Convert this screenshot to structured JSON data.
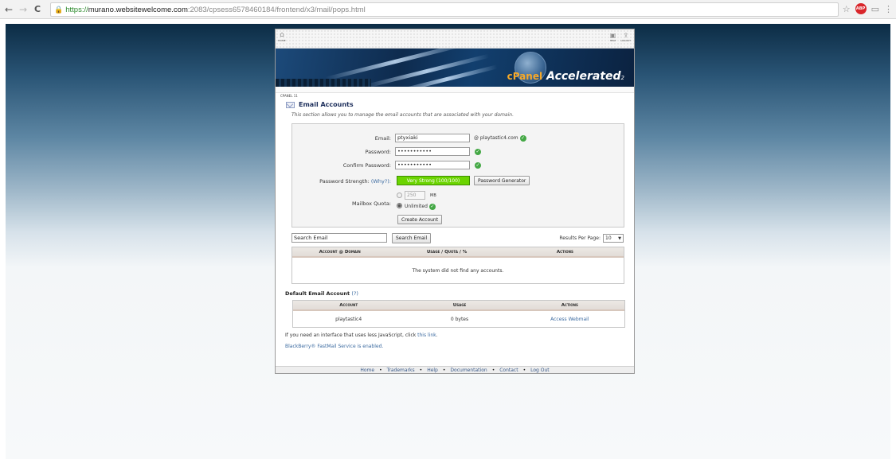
{
  "browser": {
    "url_proto": "https://",
    "url_host": "murano.websitewelcome.com",
    "url_path": ":2083/cpsess6578460184/frontend/x3/mail/pops.html",
    "adblock_label": "ABP"
  },
  "topbar": {
    "home_label": "HOME",
    "help_label": "HELP",
    "logout_label": "LOGOUT"
  },
  "banner": {
    "brand": "cPanel",
    "product": "Accelerated",
    "version_sub": "2",
    "crumb": "CPANEL 11"
  },
  "section": {
    "title": "Email Accounts",
    "description": "This section allows you to manage the email accounts that are associated with your domain."
  },
  "form": {
    "email_label": "Email:",
    "email_value": "ptyxiaki",
    "domain": "@ playtastic4.com",
    "password_label": "Password:",
    "password_value": "•••••••••••",
    "confirm_label": "Confirm Password:",
    "confirm_value": "•••••••••••",
    "strength_label": "Password Strength:",
    "why_link": "(Why?):",
    "strength_value": "Very Strong (100/100)",
    "generator_button": "Password Generator",
    "quota_label": "Mailbox Quota:",
    "quota_value": "250",
    "quota_unit": "MB",
    "unlimited_label": "Unlimited",
    "create_button": "Create Account"
  },
  "search": {
    "value": "Search Email",
    "button": "Search Email",
    "results_label": "Results Per Page:",
    "results_value": "10"
  },
  "accounts_table": {
    "col_account": "Account @ Domain",
    "col_usage": "Usage / Quota / %",
    "col_actions": "Actions",
    "empty_message": "The system did not find any accounts."
  },
  "default_account": {
    "title": "Default Email Account",
    "help": "(?)",
    "col_account": "Account",
    "col_usage": "Usage",
    "col_actions": "Actions",
    "row": {
      "account": "playtastic4",
      "usage": "0 bytes",
      "action": "Access Webmail"
    }
  },
  "notes": {
    "js_prefix": "If you need an interface that uses less JavaScript, click ",
    "js_link": "this link",
    "js_suffix": ".",
    "blackberry": "BlackBerry® FastMail Service is enabled."
  },
  "footer": {
    "links": [
      "Home",
      "Trademarks",
      "Help",
      "Documentation",
      "Contact",
      "Log Out"
    ]
  }
}
